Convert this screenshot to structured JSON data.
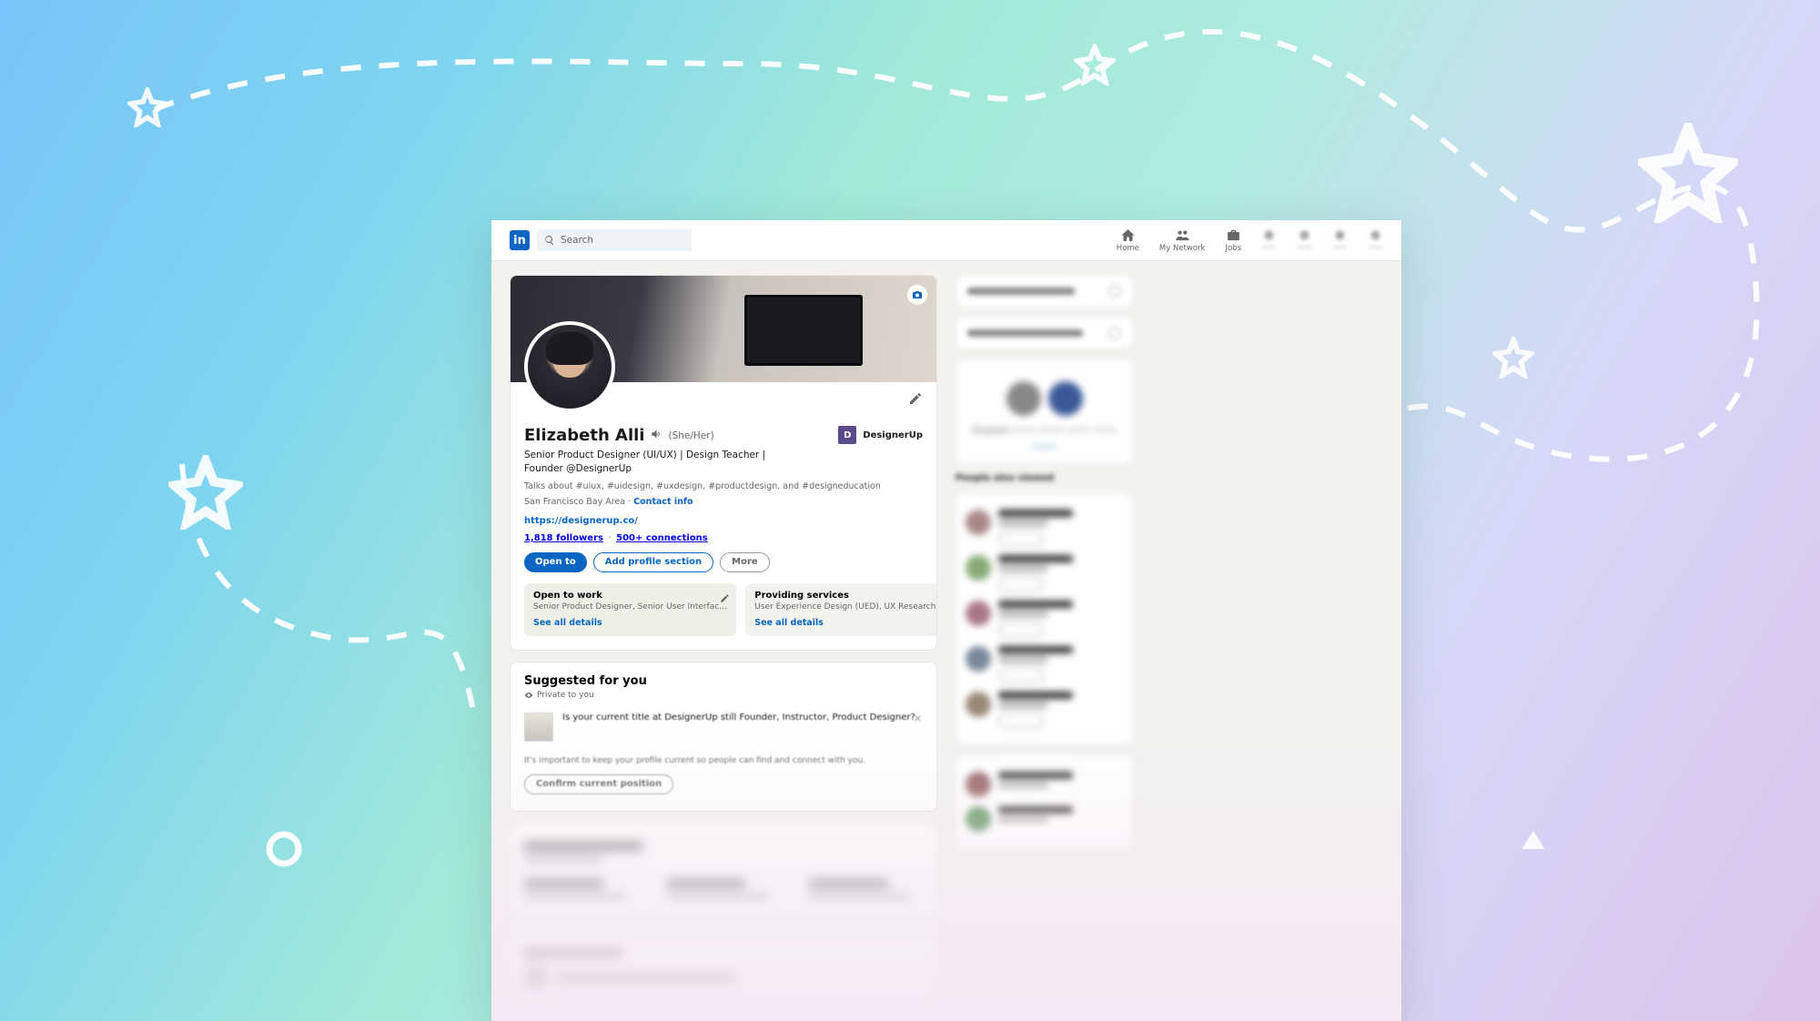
{
  "search": {
    "placeholder": "Search"
  },
  "nav": {
    "home": "Home",
    "network": "My Network",
    "jobs": "Jobs"
  },
  "profile": {
    "name": "Elizabeth Alli",
    "pronoun": "(She/Her)",
    "headline": "Senior Product Designer (UI/UX) | Design Teacher | Founder @DesignerUp",
    "talks": "Talks about #uiux, #uidesign, #uxdesign, #productdesign, and #designeducation",
    "location": "San Francisco Bay Area",
    "contact": "Contact info",
    "website": "https://designerup.co/",
    "followers": "1,818 followers",
    "connections": "500+ connections",
    "company": "DesignerUp",
    "company_initial": "D"
  },
  "buttons": {
    "open_to": "Open to",
    "add_section": "Add profile section",
    "more": "More"
  },
  "panel1": {
    "title": "Open to work",
    "desc": "Senior Product Designer, Senior User Interfac…",
    "link": "See all details"
  },
  "panel2": {
    "title": "Providing services",
    "desc": "User Experience Design (UED), UX Research, I…",
    "link": "See all details"
  },
  "suggested": {
    "title": "Suggested for you",
    "private": "Private to you",
    "question": "Is your current title at DesignerUp still Founder, Instructor, Product Designer?",
    "hint": "It's important to keep your profile current so people can find and connect with you.",
    "confirm": "Confirm current position"
  },
  "rail": {
    "people_viewed": "People also viewed"
  }
}
